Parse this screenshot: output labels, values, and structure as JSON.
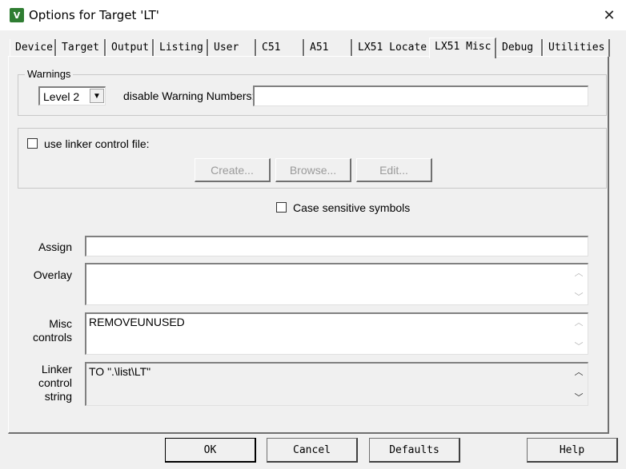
{
  "window": {
    "title": "Options for Target 'LT'",
    "icon_name": "uvision-app-icon",
    "icon_glyph": "V",
    "close_glyph": "✕"
  },
  "tabs": [
    {
      "label": "Device"
    },
    {
      "label": "Target"
    },
    {
      "label": "Output"
    },
    {
      "label": "Listing"
    },
    {
      "label": "User"
    },
    {
      "label": "C51"
    },
    {
      "label": "A51"
    },
    {
      "label": "LX51 Locate"
    },
    {
      "label": "LX51 Misc"
    },
    {
      "label": "Debug"
    },
    {
      "label": "Utilities"
    }
  ],
  "active_tab": "LX51 Misc",
  "warnings": {
    "legend": "Warnings",
    "level_value": "Level 2",
    "disable_label": "disable Warning Numbers:",
    "disable_value": ""
  },
  "linker_file": {
    "checkbox_label": "use linker control file:",
    "checked": false,
    "create_label": "Create...",
    "browse_label": "Browse...",
    "edit_label": "Edit..."
  },
  "case_sensitive": {
    "label": "Case sensitive symbols",
    "checked": false
  },
  "fields": {
    "assign_label": "Assign",
    "assign_value": "",
    "overlay_label": "Overlay",
    "overlay_value": "",
    "misc_label_1": "Misc",
    "misc_label_2": "controls",
    "misc_value": "REMOVEUNUSED",
    "linker_label_1": "Linker",
    "linker_label_2": "control",
    "linker_label_3": "string",
    "linker_value": "TO \".\\list\\LT\""
  },
  "buttons": {
    "ok": "OK",
    "cancel": "Cancel",
    "defaults": "Defaults",
    "help": "Help"
  },
  "scroll_glyphs": {
    "up": "︿",
    "down": "﹀"
  }
}
